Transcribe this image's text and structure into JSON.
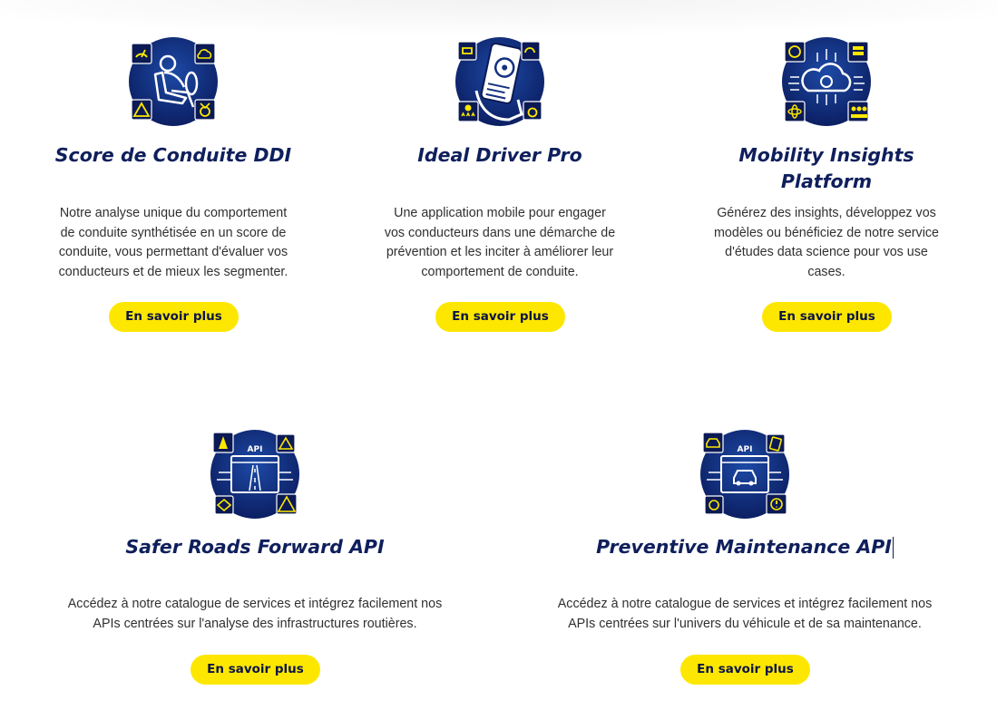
{
  "products": [
    {
      "title_lines": [
        "Score de Conduite DDI"
      ],
      "description_lines": [
        "Notre analyse unique du comportement",
        "de conduite synthétisée en un score de",
        "conduite, vous permettant d'évaluer vos",
        "conducteurs et de mieux les segmenter."
      ],
      "button_label": "En savoir plus",
      "icon": "driver-behavior-icon"
    },
    {
      "title_lines": [
        "Ideal Driver Pro"
      ],
      "description_lines": [
        "Une application mobile pour engager",
        "vos conducteurs dans une démarche de",
        "prévention et les inciter à améliorer leur",
        "comportement de conduite."
      ],
      "button_label": "En savoir plus",
      "icon": "mobile-app-icon"
    },
    {
      "title_lines": [
        "Mobility Insights",
        "Platform"
      ],
      "description_lines": [
        "Générez des insights, développez vos",
        "modèles ou bénéficiez de notre service",
        "d'études data science pour vos use",
        "cases."
      ],
      "button_label": "En savoir plus",
      "icon": "cloud-data-icon"
    },
    {
      "title_lines": [
        "Safer Roads Forward API"
      ],
      "description_lines": [
        "Accédez à notre catalogue de services et intégrez facilement nos",
        "APIs centrées sur l'analyse des infrastructures routières."
      ],
      "button_label": "En savoir plus",
      "icon": "road-api-icon",
      "icon_badge": "API"
    },
    {
      "title_lines": [
        "Preventive Maintenance API"
      ],
      "description_lines": [
        "Accédez à notre catalogue de services et intégrez facilement nos",
        "APIs centrées sur l'univers du véhicule et de sa maintenance."
      ],
      "button_label": "En savoir plus",
      "icon": "vehicle-api-icon",
      "icon_badge": "API"
    }
  ],
  "colors": {
    "navy": "#14307f",
    "navy_dark": "#0b1a55",
    "title": "#0f1f5c",
    "accent_yellow": "#fde700",
    "text": "#303030"
  }
}
